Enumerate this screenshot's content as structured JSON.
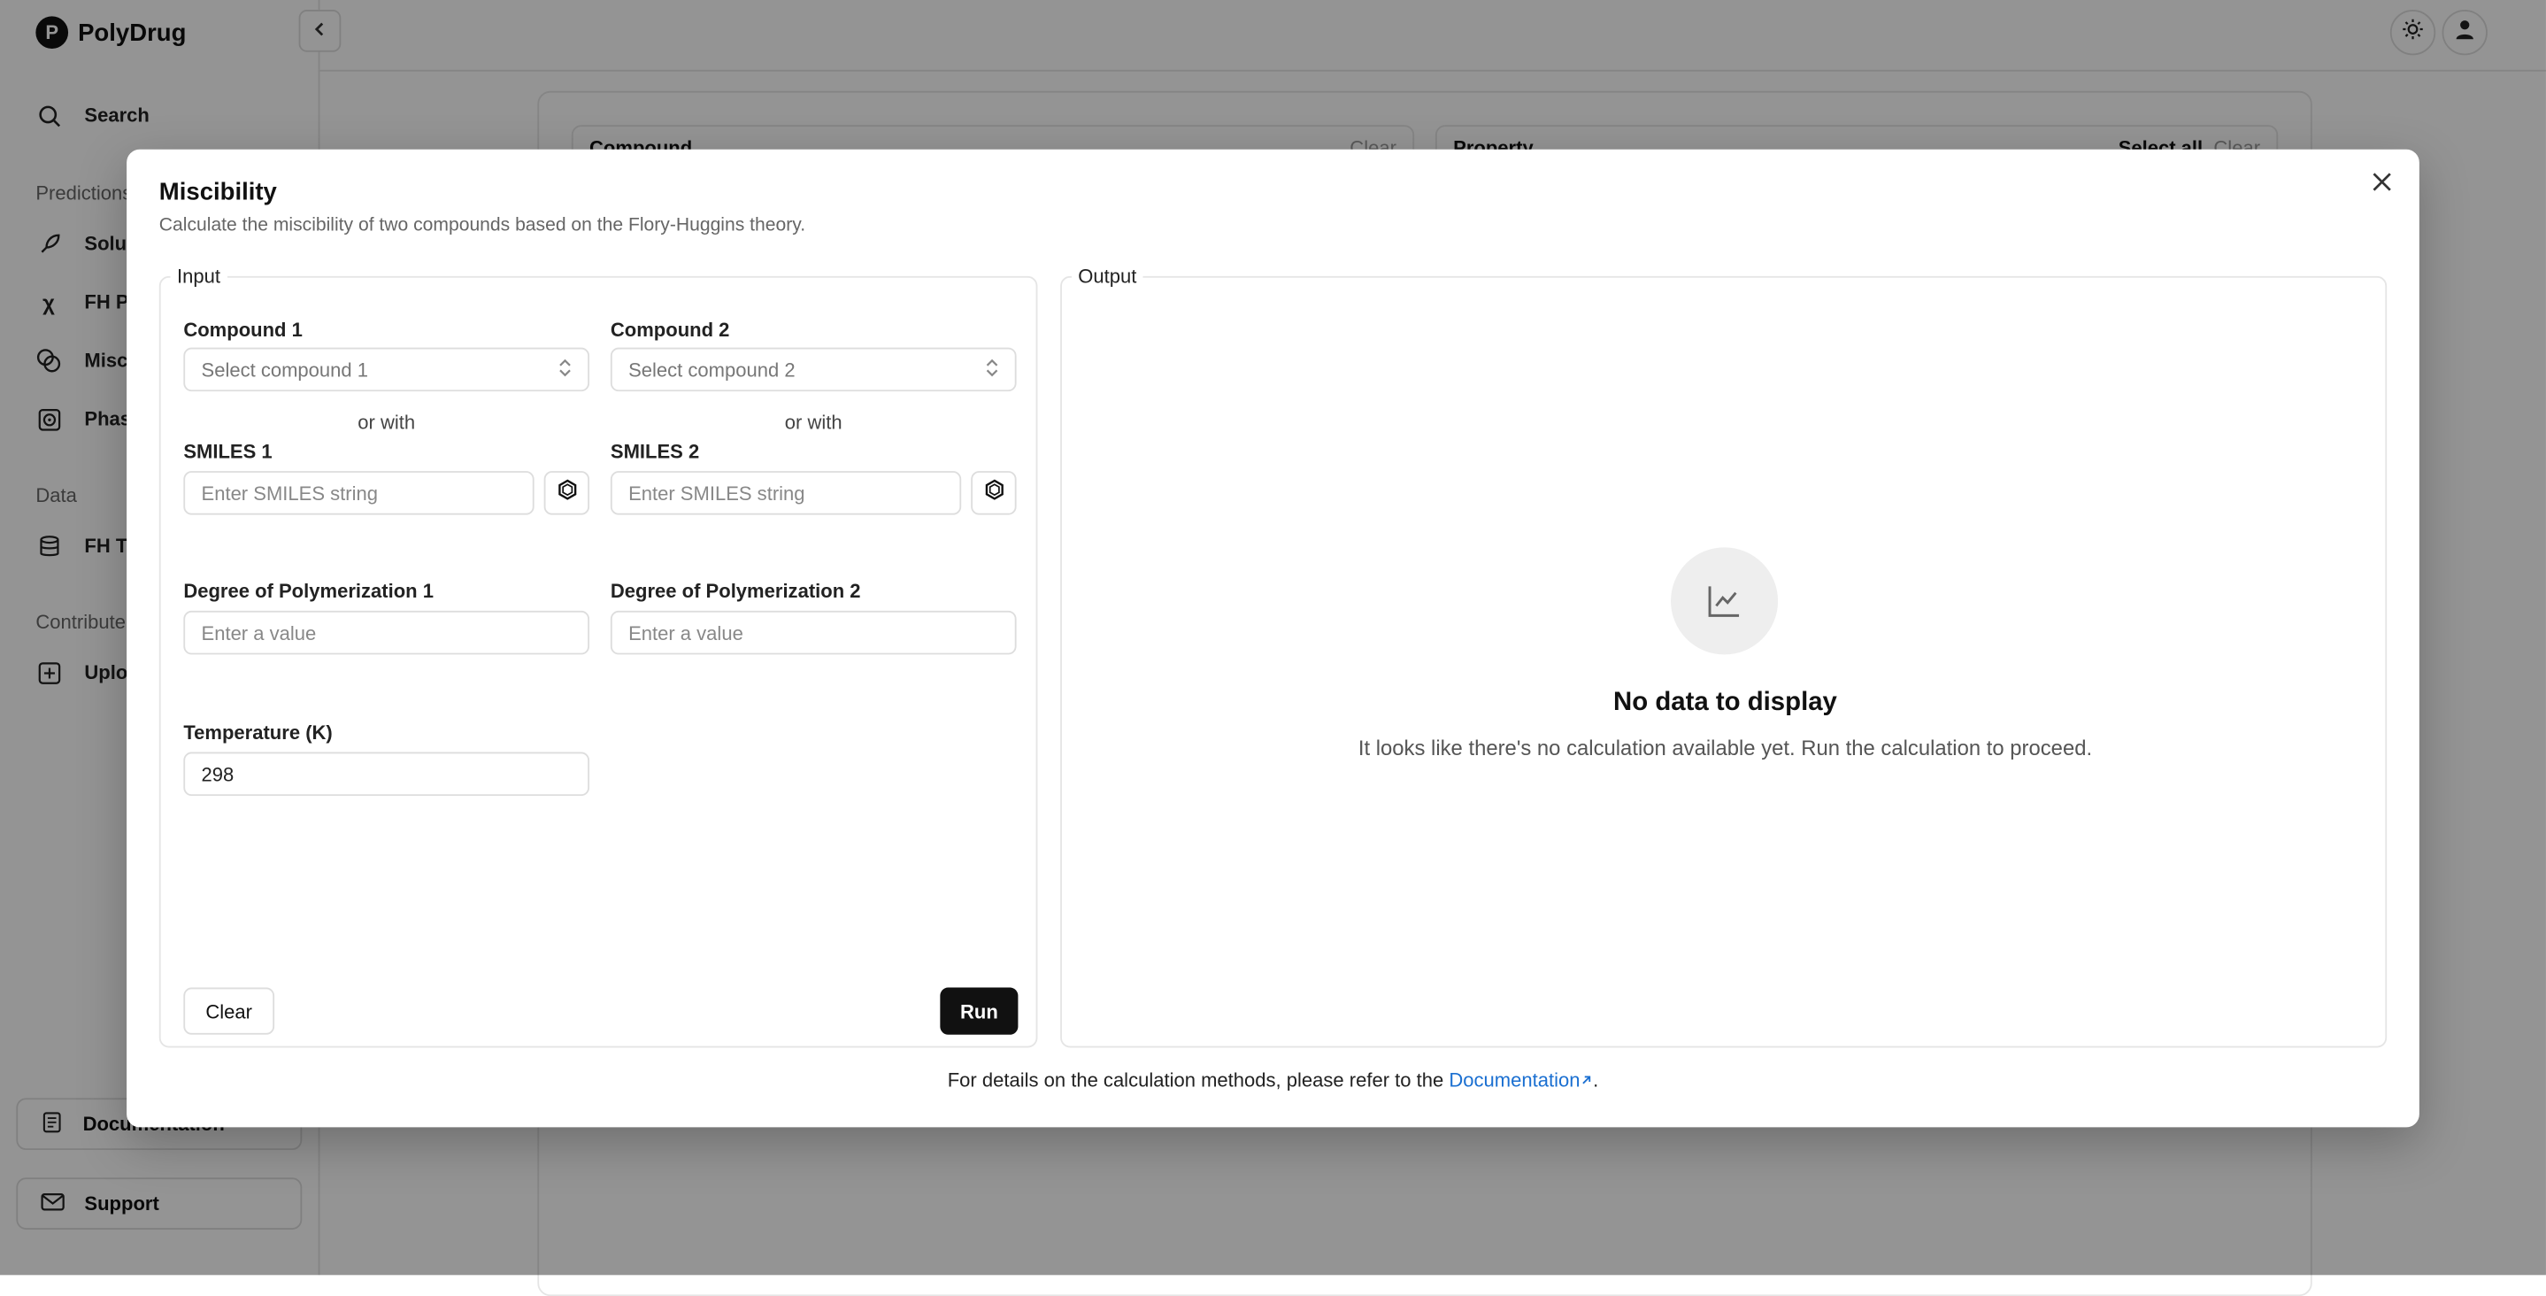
{
  "app": {
    "name": "PolyDrug",
    "logo_letter": "P"
  },
  "sidebar": {
    "search_label": "Search",
    "sections": [
      {
        "heading": "Predictions",
        "items": [
          {
            "label": "Solubility",
            "icon": "rocket-icon"
          },
          {
            "label": "FH Parameter",
            "icon": "chi-icon"
          },
          {
            "label": "Miscibility",
            "icon": "circles-icon"
          },
          {
            "label": "Phase Diagram",
            "icon": "target-icon"
          }
        ]
      },
      {
        "heading": "Data",
        "items": [
          {
            "label": "FH Table",
            "icon": "database-icon"
          }
        ]
      },
      {
        "heading": "Contribute",
        "items": [
          {
            "label": "Upload",
            "icon": "plus-square-icon"
          }
        ]
      }
    ],
    "documentation_label": "Documentation",
    "support_label": "Support"
  },
  "background": {
    "compound_label": "Compound",
    "compound_clear": "Clear",
    "property_label": "Property",
    "property_select_all": "Select all",
    "property_clear": "Clear"
  },
  "modal": {
    "title": "Miscibility",
    "subtitle": "Calculate the miscibility of two compounds based on the Flory-Huggins theory.",
    "input_legend": "Input",
    "output_legend": "Output",
    "compound1_label": "Compound 1",
    "compound1_placeholder": "Select compound 1",
    "compound2_label": "Compound 2",
    "compound2_placeholder": "Select compound 2",
    "or_with": "or with",
    "smiles1_label": "SMILES 1",
    "smiles2_label": "SMILES 2",
    "smiles_placeholder": "Enter SMILES string",
    "dp1_label": "Degree of Polymerization 1",
    "dp2_label": "Degree of Polymerization 2",
    "value_placeholder": "Enter a value",
    "temperature_label": "Temperature (K)",
    "temperature_value": "298",
    "clear_button": "Clear",
    "run_button": "Run",
    "empty_title": "No data to display",
    "empty_text": "It looks like there's no calculation available yet. Run the calculation to proceed.",
    "footer_prefix": "For details on the calculation methods, please refer to the ",
    "footer_link": "Documentation",
    "footer_suffix": "."
  }
}
